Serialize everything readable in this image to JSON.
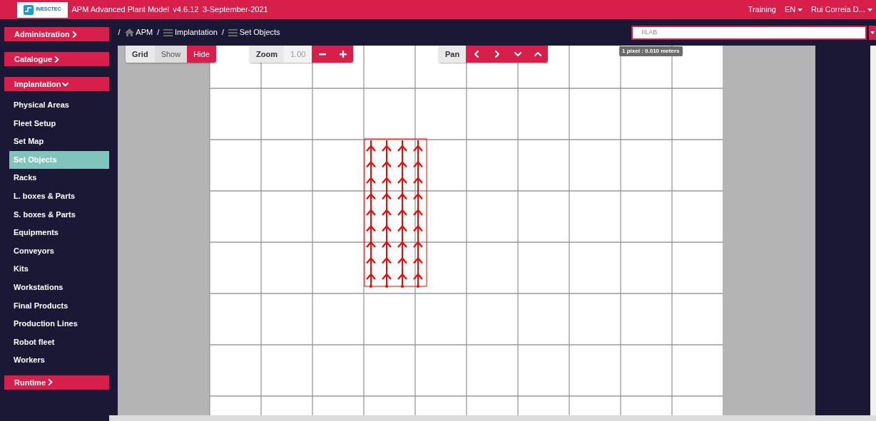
{
  "header": {
    "logo_text": "INESCTEC",
    "title": "APM Advanced Plant Model",
    "version": "v4.6.12",
    "date": "3-September-2021",
    "menu": [
      {
        "label": "Training",
        "dropdown": false
      },
      {
        "label": "EN",
        "dropdown": true
      },
      {
        "label": "Rui Correia D...",
        "dropdown": true
      }
    ]
  },
  "sidebar": {
    "entries": [
      {
        "kind": "section",
        "label": "Administration",
        "expanded": false
      },
      {
        "kind": "section",
        "label": "Catalogue",
        "expanded": false
      },
      {
        "kind": "section",
        "label": "Implantation",
        "expanded": true,
        "children": [
          {
            "label": "Physical Areas",
            "selected": false
          },
          {
            "label": "Fleet Setup",
            "selected": false
          },
          {
            "label": "Set Map",
            "selected": false
          },
          {
            "label": "Set Objects",
            "selected": true
          },
          {
            "label": "Racks",
            "selected": false
          },
          {
            "label": "L. boxes & Parts",
            "selected": false
          },
          {
            "label": "S. boxes & Parts",
            "selected": false
          },
          {
            "label": "Equipments",
            "selected": false
          },
          {
            "label": "Conveyors",
            "selected": false
          },
          {
            "label": "Kits",
            "selected": false
          },
          {
            "label": "Workstations",
            "selected": false
          },
          {
            "label": "Final Products",
            "selected": false
          },
          {
            "label": "Production Lines",
            "selected": false
          },
          {
            "label": "Robot fleet",
            "selected": false
          },
          {
            "label": "Workers",
            "selected": false
          }
        ]
      },
      {
        "kind": "section",
        "label": "Runtime",
        "expanded": false
      }
    ]
  },
  "breadcrumb": [
    {
      "separator": "/",
      "kind": "home",
      "label": "APM"
    },
    {
      "separator": "/",
      "kind": "list",
      "label": "Implantation"
    },
    {
      "separator": "/",
      "kind": "list",
      "label": "Set Objects"
    }
  ],
  "site_select": {
    "value": "IILAB"
  },
  "toolbar": {
    "grid": {
      "label": "Grid",
      "options": [
        {
          "label": "Show",
          "selected": false
        },
        {
          "label": "Hide",
          "selected": true
        }
      ]
    },
    "zoom": {
      "label": "Zoom",
      "value": "1.00"
    },
    "pan": {
      "label": "Pan"
    }
  },
  "scale": "1 pixel : 0.010 meters"
}
